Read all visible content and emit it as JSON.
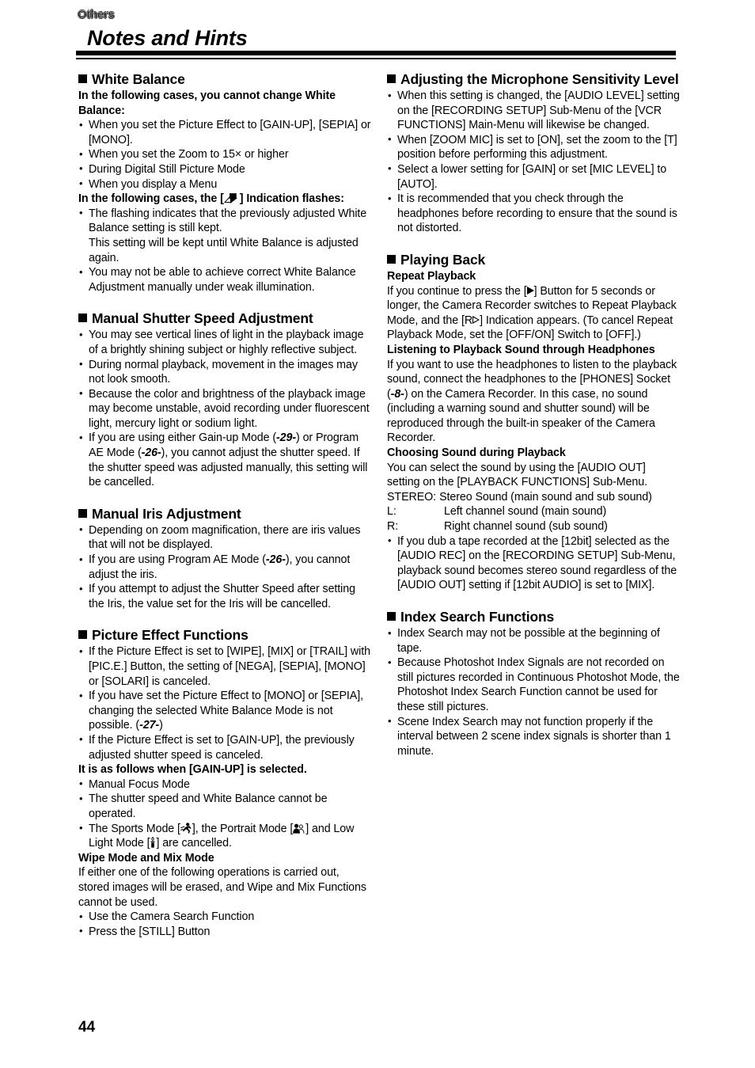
{
  "header": {
    "kicker": "Others",
    "title": "Notes and Hints"
  },
  "footer": {
    "page_number": "44"
  },
  "icons": {
    "section_marker": "filled-square-bullet",
    "white_balance_indication": "white-balance-icon",
    "sports_mode": "sports-running-icon",
    "portrait_mode": "portrait-bust-icon",
    "low_light_mode": "low-light-candle-icon",
    "play_solid": "play-solid-icon",
    "play_hollow": "play-hollow-icon"
  },
  "left_column": {
    "sections": [
      {
        "heading": "White Balance",
        "blocks": [
          {
            "type": "subhead",
            "text": "In the following cases, you cannot change White Balance:"
          },
          {
            "type": "bullets",
            "items": [
              "When you set the Picture Effect to [GAIN-UP], [SEPIA] or [MONO].",
              "When you set the Zoom to 15× or higher",
              "During Digital Still Picture Mode",
              "When you display a Menu"
            ]
          },
          {
            "type": "subhead_icon",
            "text_before": "In the following cases, the [",
            "icon": "white-balance-icon",
            "text_after": "] Indication flashes:"
          },
          {
            "type": "bullets",
            "items": [
              "The flashing indicates that the previously adjusted White Balance setting is still kept.\nThis setting will be kept until White Balance is adjusted again.",
              "You may not be able to achieve correct White Balance Adjustment manually under weak illumination."
            ]
          }
        ]
      },
      {
        "heading": "Manual Shutter Speed Adjustment",
        "blocks": [
          {
            "type": "bullets",
            "items": [
              "You may see vertical lines of light in the playback image of a brightly shining subject or highly reflective subject.",
              "During normal playback, movement in the images may not look smooth.",
              "Because the color and brightness of the playback image may become unstable, avoid recording under fluorescent light, mercury light or sodium light."
            ]
          },
          {
            "type": "bullet_refs",
            "parts": [
              {
                "t": "If you are using either Gain-up Mode ("
              },
              {
                "t": "-29-",
                "style": "pref"
              },
              {
                "t": ") or Program AE Mode ("
              },
              {
                "t": "-26-",
                "style": "pref"
              },
              {
                "t": "), you cannot adjust the shutter speed. If the shutter speed was adjusted manually, this setting will be cancelled."
              }
            ]
          }
        ]
      },
      {
        "heading": "Manual Iris Adjustment",
        "blocks": [
          {
            "type": "bullets",
            "items": [
              "Depending on zoom magnification, there are iris values that will not be displayed."
            ]
          },
          {
            "type": "bullet_refs",
            "parts": [
              {
                "t": "If you are using Program AE Mode ("
              },
              {
                "t": "-26-",
                "style": "pref"
              },
              {
                "t": "), you cannot adjust the iris."
              }
            ]
          },
          {
            "type": "bullets",
            "items": [
              "If you attempt to adjust the Shutter Speed after setting the Iris, the value set for the Iris will be cancelled."
            ]
          }
        ]
      },
      {
        "heading": "Picture Effect Functions",
        "blocks": [
          {
            "type": "bullets",
            "items": [
              "If the Picture Effect is set to [WIPE], [MIX] or [TRAIL] with [PIC.E.] Button, the setting of [NEGA], [SEPIA], [MONO] or [SOLARI] is canceled."
            ]
          },
          {
            "type": "bullet_refs",
            "parts": [
              {
                "t": "If you have set the Picture Effect to [MONO] or [SEPIA], changing the selected White Balance Mode is not possible. ("
              },
              {
                "t": "-27-",
                "style": "pref"
              },
              {
                "t": ")"
              }
            ]
          },
          {
            "type": "bullets",
            "items": [
              "If the Picture Effect is set to [GAIN-UP], the previously adjusted shutter speed is canceled."
            ]
          },
          {
            "type": "subhead",
            "text": "It is as follows when [GAIN-UP] is selected."
          },
          {
            "type": "bullets",
            "items": [
              "Manual Focus Mode",
              "The shutter speed and White Balance cannot be operated."
            ]
          },
          {
            "type": "bullet_modes",
            "text_1": "The Sports Mode [",
            "icon_1": "sports-running-icon",
            "text_2": "], the Portrait Mode [",
            "icon_2": "portrait-bust-icon",
            "text_3": "] and Low Light Mode [",
            "icon_3": "low-light-candle-icon",
            "text_4": "] are cancelled."
          },
          {
            "type": "subhead",
            "text": "Wipe Mode and Mix Mode"
          },
          {
            "type": "para",
            "text": "If either one of the following operations is carried out, stored images will be erased, and Wipe and Mix Functions cannot be used."
          },
          {
            "type": "bullets",
            "items": [
              "Use the Camera Search Function",
              "Press the [STILL] Button"
            ]
          }
        ]
      }
    ]
  },
  "right_column": {
    "sections": [
      {
        "heading": "Adjusting the Microphone Sensitivity Level",
        "blocks": [
          {
            "type": "bullets",
            "items": [
              "When this setting is changed, the [AUDIO LEVEL] setting on the [RECORDING SETUP] Sub-Menu of the [VCR FUNCTIONS] Main-Menu will likewise be changed.",
              "When [ZOOM MIC] is set to [ON], set the zoom to the [T] position before performing this adjustment.",
              "Select a lower setting for [GAIN] or set [MIC LEVEL] to [AUTO].",
              "It is recommended that you check through the headphones before recording to ensure that the sound is not distorted."
            ]
          }
        ]
      },
      {
        "heading": "Playing Back",
        "blocks": [
          {
            "type": "subhead",
            "text": "Repeat Playback"
          },
          {
            "type": "para_icons",
            "p1": "If you continue to press the [",
            "icon_1": "play-solid-icon",
            "p2": "] Button for 5 seconds or longer, the Camera Recorder switches to Repeat Playback Mode, and the [R",
            "icon_2": "play-hollow-icon",
            "p3": "] Indication appears. (To cancel Repeat Playback Mode, set the [OFF/ON] Switch to [OFF].)"
          },
          {
            "type": "subhead",
            "text": "Listening to Playback Sound through Headphones"
          },
          {
            "type": "para_refs",
            "parts": [
              {
                "t": "If you want to use the headphones to listen to the playback sound, connect the headphones to the [PHONES] Socket ("
              },
              {
                "t": "-8-",
                "style": "pref"
              },
              {
                "t": ") on the Camera Recorder. In this case, no sound (including a warning sound and shutter sound) will be reproduced through the built-in speaker of the Camera Recorder."
              }
            ]
          },
          {
            "type": "subhead",
            "text": "Choosing Sound during Playback"
          },
          {
            "type": "para",
            "text": "You can select the sound by using the [AUDIO OUT] setting on the [PLAYBACK FUNCTIONS] Sub-Menu."
          },
          {
            "type": "defs",
            "rows": [
              {
                "key": "STEREO:",
                "value": "Stereo Sound (main sound and sub sound)",
                "inline": true
              },
              {
                "key": "L:",
                "value": "Left channel sound (main sound)",
                "inline": false
              },
              {
                "key": "R:",
                "value": "Right channel sound (sub sound)",
                "inline": false
              }
            ]
          },
          {
            "type": "bullets",
            "items": [
              "If you dub a tape recorded at the [12bit] selected as the [AUDIO REC] on the [RECORDING SETUP] Sub-Menu, playback sound becomes stereo sound regardless of the [AUDIO OUT] setting if [12bit AUDIO] is set to [MIX]."
            ]
          }
        ]
      },
      {
        "heading": "Index Search Functions",
        "blocks": [
          {
            "type": "bullets",
            "items": [
              "Index Search may not be possible at the beginning of tape.",
              "Because Photoshot Index Signals are not recorded on still pictures recorded in Continuous Photoshot Mode, the Photoshot Index Search Function cannot be used for these still pictures.",
              "Scene Index Search may not function properly if the interval between 2 scene index signals is shorter than 1 minute."
            ]
          }
        ]
      }
    ]
  }
}
